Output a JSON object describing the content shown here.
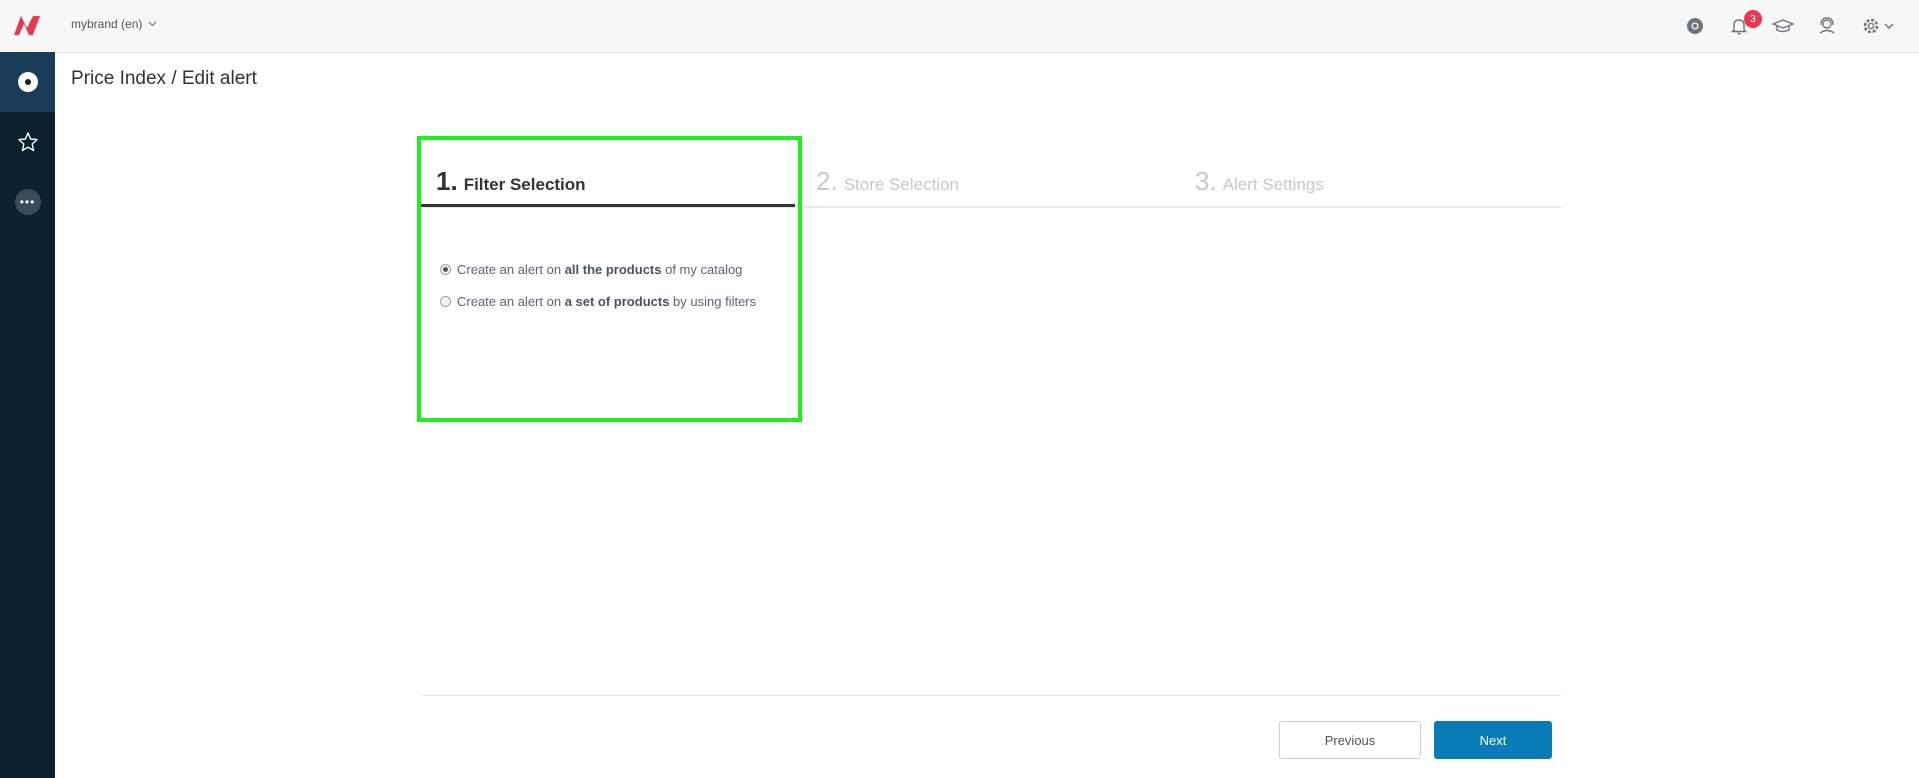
{
  "header": {
    "brand_label": "mybrand (en)",
    "notification_count": "3"
  },
  "page": {
    "title": "Price Index / Edit alert"
  },
  "steps": [
    {
      "number": "1.",
      "label": "Filter Selection",
      "active": true
    },
    {
      "number": "2.",
      "label": "Store Selection",
      "active": false
    },
    {
      "number": "3.",
      "label": "Alert Settings",
      "active": false
    }
  ],
  "options": [
    {
      "prefix": "Create an alert on ",
      "bold": "all the products",
      "suffix": " of my catalog",
      "checked": true
    },
    {
      "prefix": "Create an alert on ",
      "bold": "a set of products",
      "suffix": " by using filters",
      "checked": false
    }
  ],
  "buttons": {
    "previous": "Previous",
    "next": "Next"
  },
  "colors": {
    "sidebar": "#0c2130",
    "accent": "#0a7cb8",
    "brand_red": "#e8384f",
    "highlight": "#1ef01e"
  }
}
